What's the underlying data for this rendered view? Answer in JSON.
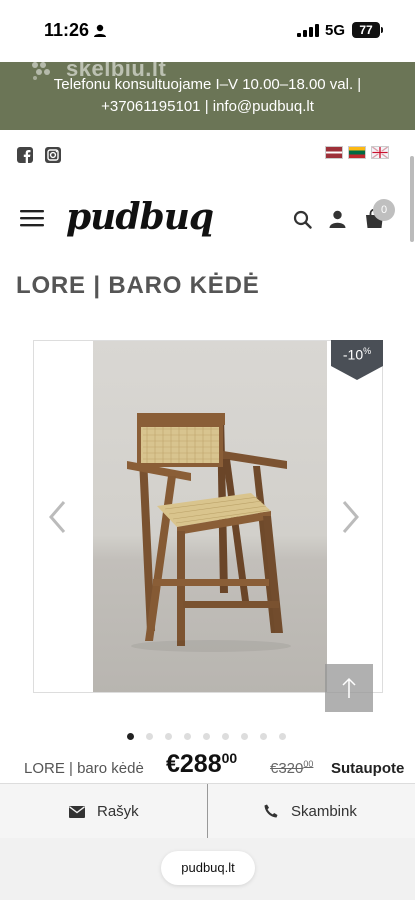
{
  "status_bar": {
    "time": "11:26",
    "network": "5G",
    "battery": "77"
  },
  "banner": {
    "watermark": "skelbiu.lt",
    "line1": "Telefonu konsultuojame I–V 10.00–18.00 val. |",
    "line2": "+37061195101 | info@pudbuq.lt"
  },
  "social": {
    "icons": [
      "facebook-icon",
      "instagram-icon"
    ],
    "languages": [
      "lv",
      "lt",
      "en"
    ]
  },
  "header": {
    "logo": "pudbuq",
    "cart_count": "0"
  },
  "product": {
    "title": "LORE | BARO KĖDĖ",
    "discount_value": "-10",
    "discount_unit": "%",
    "gallery_dots": 9,
    "active_dot": 0
  },
  "price": {
    "name": "LORE | baro kėdė",
    "current_main": "€288",
    "current_cents": "00",
    "old_main": "€320",
    "old_cents": "00",
    "savings_label": "Sutaupote"
  },
  "actions": {
    "write_label": "Rašyk",
    "call_label": "Skambink"
  },
  "browser": {
    "url": "pudbuq.lt"
  },
  "colors": {
    "banner_bg": "#6b7556",
    "discount_bg": "#4a4f56"
  }
}
